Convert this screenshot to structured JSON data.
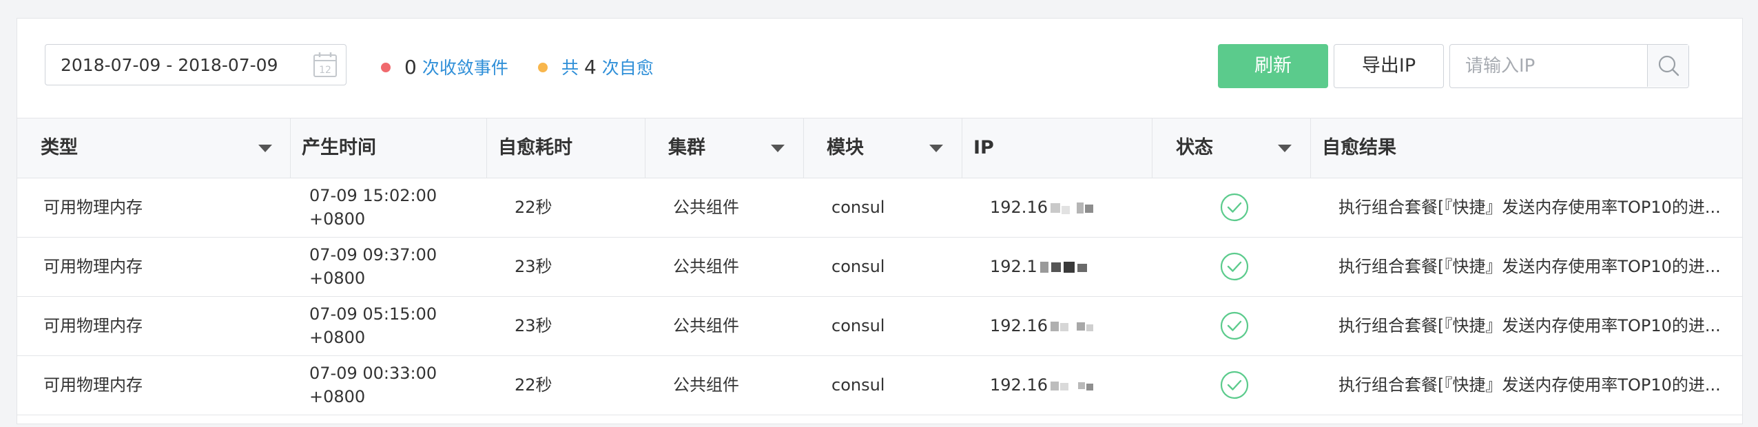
{
  "toolbar": {
    "date_range": "2018-07-09 - 2018-07-09",
    "calendar_day": "12",
    "stat1": {
      "count": "0",
      "label": "次收敛事件",
      "dot_color": "#f0696d"
    },
    "stat2": {
      "prefix": "共",
      "count": "4",
      "label": "次自愈",
      "dot_color": "#f8b64c"
    },
    "refresh_label": "刷新",
    "export_label": "导出IP",
    "search_placeholder": "请输入IP",
    "accent_color": "#5bcb8c",
    "link_color": "#2f8fd8"
  },
  "table": {
    "columns": [
      {
        "label": "类型",
        "filter": true
      },
      {
        "label": "产生时间",
        "filter": false
      },
      {
        "label": "自愈耗时",
        "filter": false
      },
      {
        "label": "集群",
        "filter": true
      },
      {
        "label": "模块",
        "filter": true
      },
      {
        "label": "IP",
        "filter": false
      },
      {
        "label": "状态",
        "filter": true
      },
      {
        "label": "自愈结果",
        "filter": false
      }
    ],
    "rows": [
      {
        "type": "可用物理内存",
        "time1": "07-09 15:02:00",
        "time2": "+0800",
        "duration": "22秒",
        "cluster": "公共组件",
        "module": "consul",
        "ip": "192.16",
        "status": "success-icon",
        "result": "执行组合套餐[『快捷』发送内存使用率TOP10的进..."
      },
      {
        "type": "可用物理内存",
        "time1": "07-09 09:37:00",
        "time2": "+0800",
        "duration": "23秒",
        "cluster": "公共组件",
        "module": "consul",
        "ip": "192.1",
        "status": "success-icon",
        "result": "执行组合套餐[『快捷』发送内存使用率TOP10的进..."
      },
      {
        "type": "可用物理内存",
        "time1": "07-09 05:15:00",
        "time2": "+0800",
        "duration": "23秒",
        "cluster": "公共组件",
        "module": "consul",
        "ip": "192.16",
        "status": "success-icon",
        "result": "执行组合套餐[『快捷』发送内存使用率TOP10的进..."
      },
      {
        "type": "可用物理内存",
        "time1": "07-09 00:33:00",
        "time2": "+0800",
        "duration": "22秒",
        "cluster": "公共组件",
        "module": "consul",
        "ip": "192.16",
        "status": "success-icon",
        "result": "执行组合套餐[『快捷』发送内存使用率TOP10的进..."
      }
    ]
  }
}
